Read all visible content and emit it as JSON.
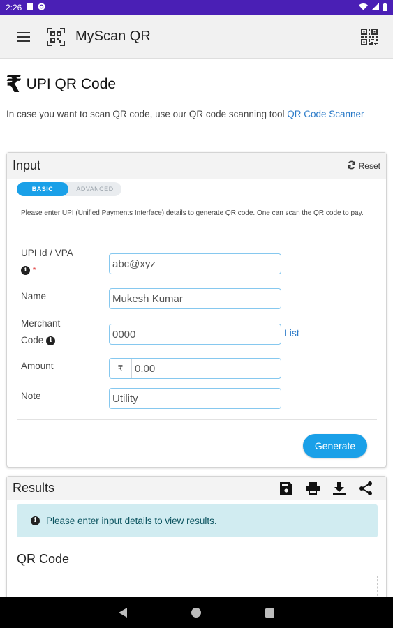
{
  "status_bar": {
    "time": "2:26"
  },
  "app_bar": {
    "title": "MyScan QR"
  },
  "page": {
    "title": "UPI QR Code",
    "intro_text": "In case you want to scan QR code, use our QR code scanning tool ",
    "intro_link": "QR Code Scanner"
  },
  "input_card": {
    "title": "Input",
    "reset_label": "Reset",
    "tabs": [
      {
        "label": "BASIC",
        "active": true
      },
      {
        "label": "ADVANCED",
        "active": false
      }
    ],
    "description": "Please enter UPI (Unified Payments Interface) details to generate QR code. One can scan the QR code to pay.",
    "fields": {
      "upi_id": {
        "label_line1": "UPI Id / VPA",
        "required_mark": "*",
        "placeholder": "abc@xyz"
      },
      "name": {
        "label": "Name",
        "placeholder": "Mukesh Kumar"
      },
      "merchant_code": {
        "label_line1": "Merchant",
        "label_line2": "Code",
        "placeholder": "0000",
        "list_link": "List"
      },
      "amount": {
        "label": "Amount",
        "prefix": "₹",
        "placeholder": "0.00"
      },
      "note": {
        "label": "Note",
        "placeholder": "Utility"
      }
    },
    "generate_label": "Generate"
  },
  "results_card": {
    "title": "Results",
    "actions": [
      "save-icon",
      "print-icon",
      "download-icon",
      "share-icon"
    ],
    "alert_text": "Please enter input details to view results.",
    "qr_heading": "QR Code"
  },
  "colors": {
    "status_bar": "#4a1fb5",
    "accent": "#1aa0e8",
    "link": "#2a7ac8",
    "alert_bg": "#d1ecf1"
  }
}
